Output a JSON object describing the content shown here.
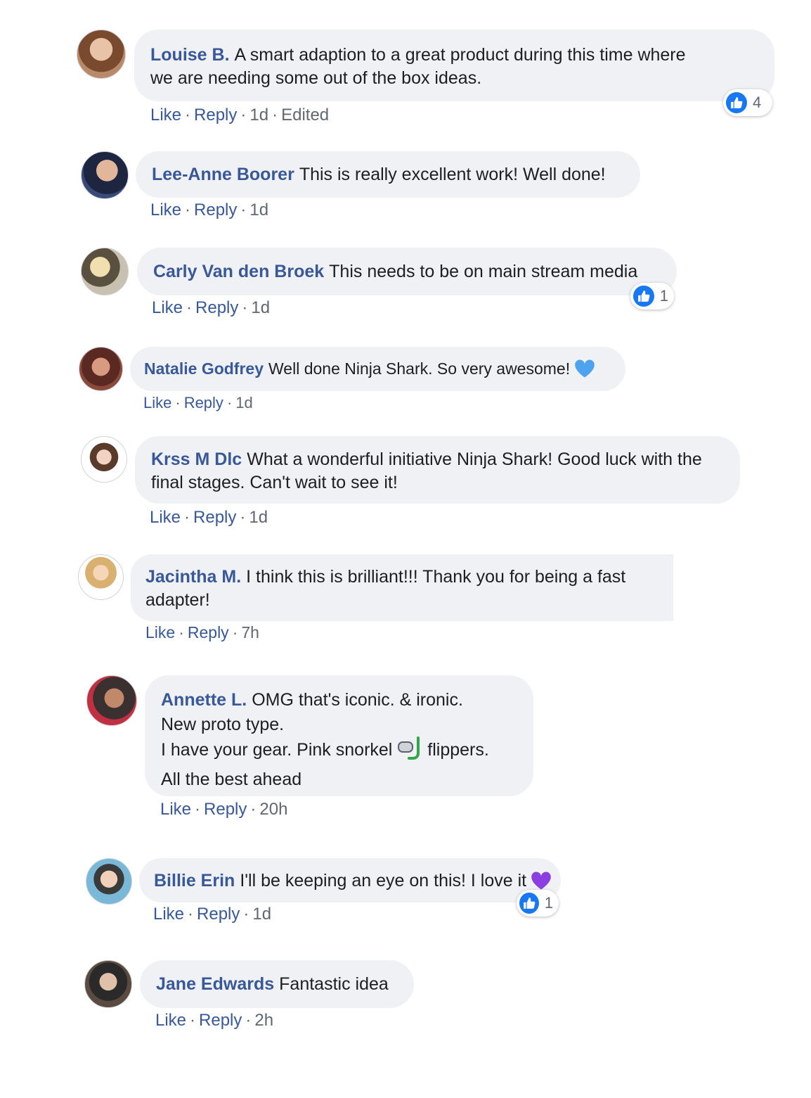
{
  "comments": [
    {
      "author": "Louise B.",
      "text_lines": [
        "A smart adaption to a great product during this time where",
        "we are needing some out of the box ideas."
      ],
      "like": "Like",
      "reply": "Reply",
      "time": "1d",
      "edited": "Edited",
      "reactions": "4"
    },
    {
      "author": "Lee-Anne Boorer",
      "text_lines": [
        "This is really excellent work! Well done!"
      ],
      "like": "Like",
      "reply": "Reply",
      "time": "1d"
    },
    {
      "author": "Carly Van den Broek",
      "text_lines": [
        "This needs to be on main stream media"
      ],
      "like": "Like",
      "reply": "Reply",
      "time": "1d",
      "reactions": "1"
    },
    {
      "author": "Natalie Godfrey",
      "text_lines": [
        "Well done Ninja Shark. So very awesome!"
      ],
      "like": "Like",
      "reply": "Reply",
      "time": "1d",
      "emoji": "blue-heart-icon"
    },
    {
      "author": "Krss M Dlc",
      "text_lines": [
        "What a wonderful initiative Ninja Shark! Good luck with the",
        "final stages. Can't wait to see it!"
      ],
      "like": "Like",
      "reply": "Reply",
      "time": "1d"
    },
    {
      "author": "Jacintha M.",
      "text_lines": [
        "I think this is brilliant!!! Thank you for being a fast",
        "adapter!"
      ],
      "like": "Like",
      "reply": "Reply",
      "time": "7h"
    },
    {
      "author": "Annette L.",
      "text_lines": [
        "OMG that's iconic. & ironic.",
        "New proto type.",
        "I have your gear. Pink snorkel",
        "flippers.",
        "All the best ahead"
      ],
      "like": "Like",
      "reply": "Reply",
      "time": "20h",
      "emoji": "snorkel-icon"
    },
    {
      "author": "Billie Erin",
      "text_lines": [
        "I'll be keeping an eye on this! I love it"
      ],
      "like": "Like",
      "reply": "Reply",
      "time": "1d",
      "reactions": "1",
      "emoji": "purple-heart-icon"
    },
    {
      "author": "Jane Edwards",
      "text_lines": [
        "Fantastic idea"
      ],
      "like": "Like",
      "reply": "Reply",
      "time": "2h"
    }
  ],
  "colors": {
    "link": "#385898",
    "bubble": "#eff1f4",
    "like_blue": "#1877f2",
    "blue_heart": "#4fa3ee",
    "purple_heart": "#8c3fe0"
  }
}
